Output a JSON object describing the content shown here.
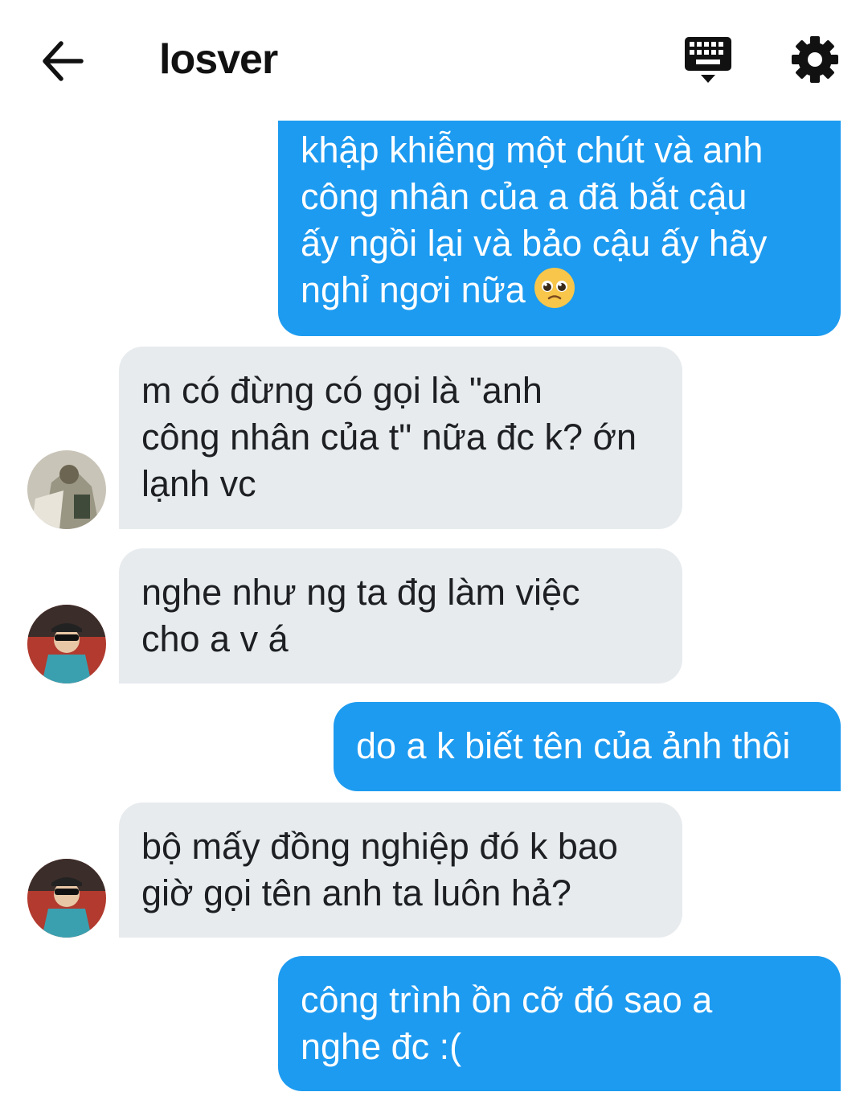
{
  "header": {
    "title": "losver",
    "back_icon": "arrow-left-icon",
    "keyboard_icon": "keyboard-icon",
    "settings_icon": "gear-icon"
  },
  "colors": {
    "outgoing_bubble": "#1d9bf0",
    "incoming_bubble": "#e7ebee"
  },
  "messages": [
    {
      "direction": "out",
      "text": "khập khiễng một chút và anh\ncông nhân của a đã bắt cậu\nấy ngồi lại và bảo cậu ấy hãy\nnghỉ ngơi nữa",
      "emoji": "pleading-face-emoji"
    },
    {
      "direction": "in",
      "text": "m có đừng có gọi là \"anh\ncông nhân của t\" nữa đc k? ớn\nlạnh vc"
    },
    {
      "direction": "in",
      "text": "nghe như ng ta đg làm việc\ncho a v á"
    },
    {
      "direction": "out",
      "text": "do a k biết tên của ảnh thôi"
    },
    {
      "direction": "in",
      "text": "bộ mấy đồng nghiệp đó k bao\ngiờ gọi tên anh ta luôn hả?"
    },
    {
      "direction": "out",
      "text": "công trình ồn cỡ đó sao a\nnghe đc :("
    }
  ]
}
